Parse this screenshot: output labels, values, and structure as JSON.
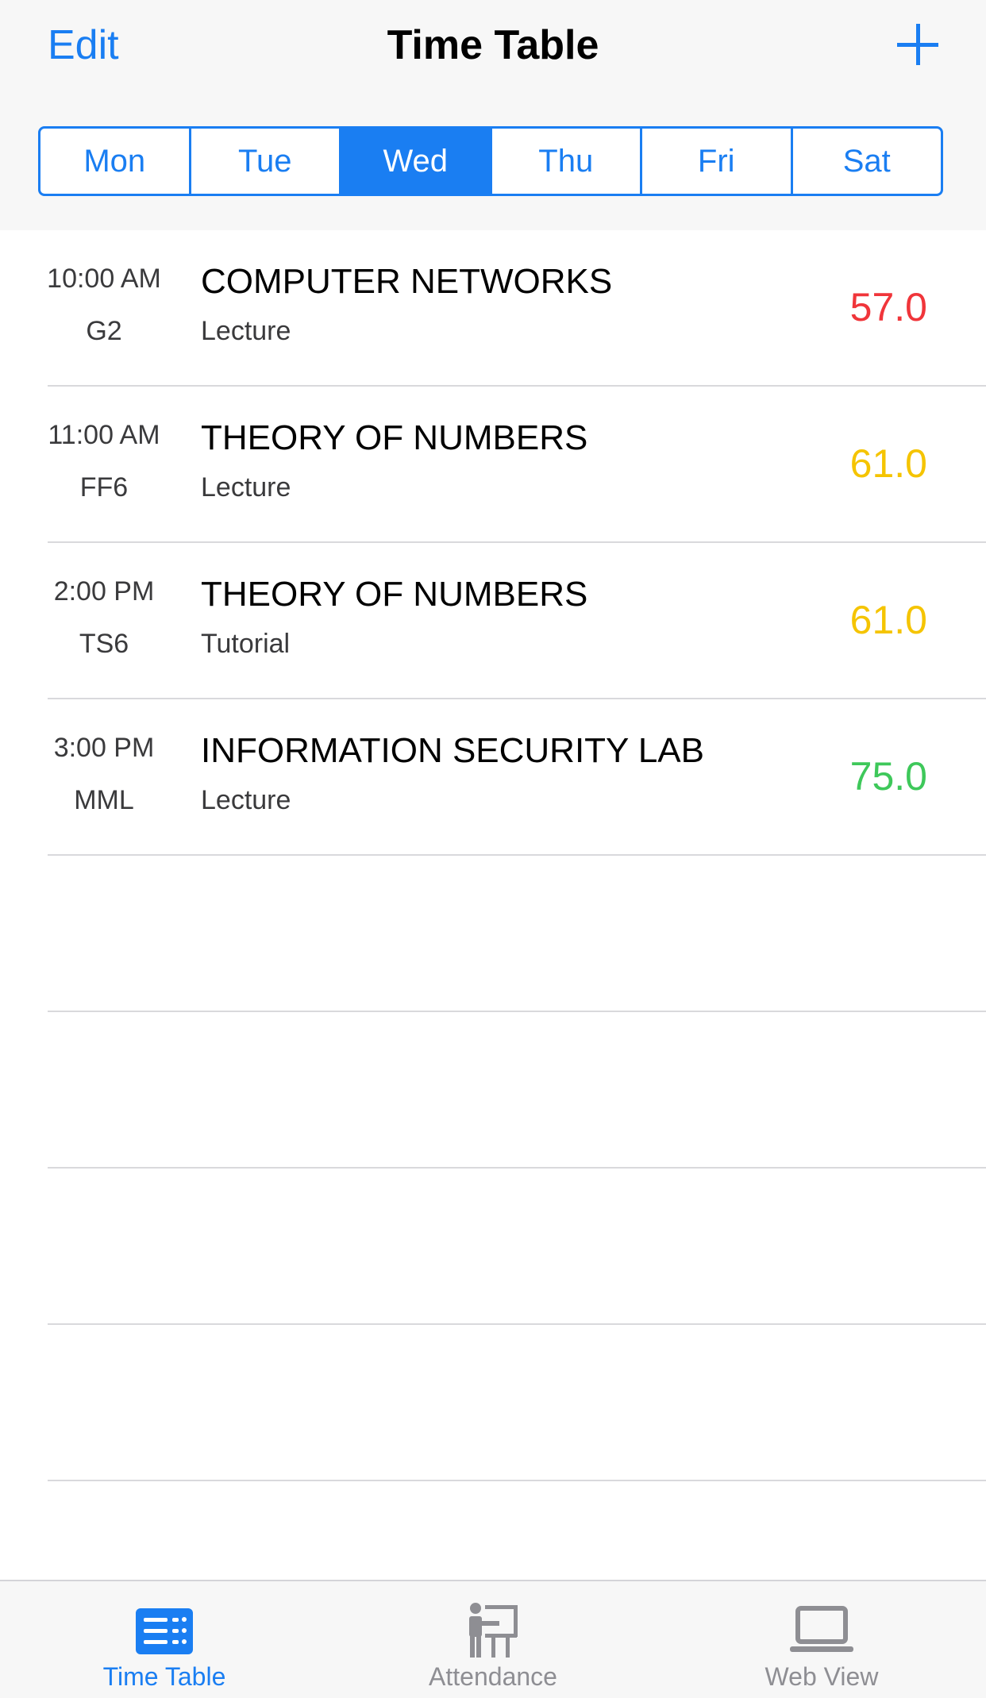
{
  "header": {
    "edit_label": "Edit",
    "title": "Time Table",
    "add_icon": "plus-icon"
  },
  "days": [
    {
      "label": "Mon",
      "active": false
    },
    {
      "label": "Tue",
      "active": false
    },
    {
      "label": "Wed",
      "active": true
    },
    {
      "label": "Thu",
      "active": false
    },
    {
      "label": "Fri",
      "active": false
    },
    {
      "label": "Sat",
      "active": false
    }
  ],
  "classes": [
    {
      "time": "10:00 AM",
      "room": "G2",
      "subject": "COMPUTER NETWORKS",
      "type": "Lecture",
      "attendance": "57.0",
      "color": "#f0353a"
    },
    {
      "time": "11:00 AM",
      "room": "FF6",
      "subject": "THEORY OF NUMBERS",
      "type": "Lecture",
      "attendance": "61.0",
      "color": "#f5c400"
    },
    {
      "time": "2:00 PM",
      "room": "TS6",
      "subject": "THEORY OF NUMBERS",
      "type": "Tutorial",
      "attendance": "61.0",
      "color": "#f5c400"
    },
    {
      "time": "3:00 PM",
      "room": "MML",
      "subject": "INFORMATION SECURITY LAB",
      "type": "Lecture",
      "attendance": "75.0",
      "color": "#3ec85a"
    }
  ],
  "tabs": [
    {
      "label": "Time Table",
      "icon": "timetable-list-icon",
      "active": true
    },
    {
      "label": "Attendance",
      "icon": "teacher-board-icon",
      "active": false
    },
    {
      "label": "Web View",
      "icon": "laptop-icon",
      "active": false
    }
  ],
  "colors": {
    "accent": "#1a7ef2",
    "inactive": "#8e8e93"
  }
}
